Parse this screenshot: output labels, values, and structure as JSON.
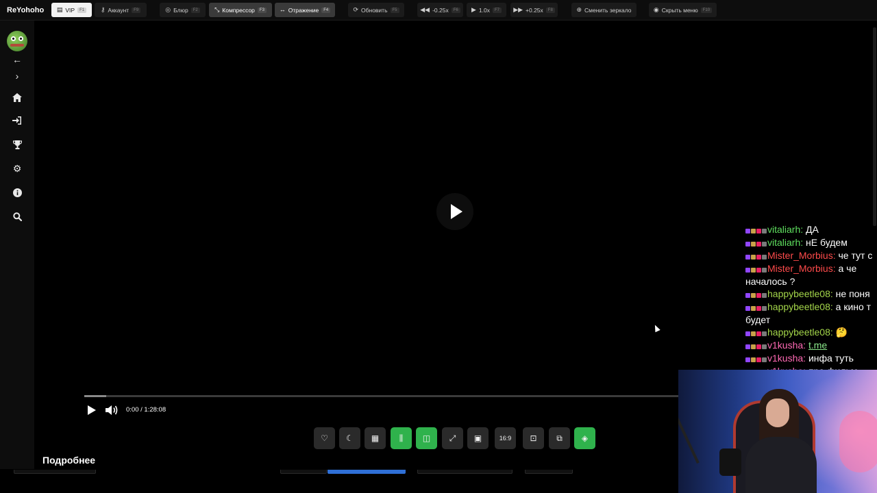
{
  "topbar": {
    "brand": "ReYohoho",
    "buttons": [
      {
        "label": "VIP",
        "key": "F1"
      },
      {
        "label": "Аккаунт",
        "key": "F9"
      },
      {
        "label": "Блюр",
        "key": "F2"
      },
      {
        "label": "Компрессор",
        "key": "F3"
      },
      {
        "label": "Отражение",
        "key": "F4"
      },
      {
        "label": "Обновить",
        "key": "F5"
      },
      {
        "label": "-0.25x",
        "key": "F6"
      },
      {
        "label": "1.0x",
        "key": "F7"
      },
      {
        "label": "+0.25x",
        "key": "F8"
      },
      {
        "label": "Сменить зеркало"
      },
      {
        "label": "Скрыть меню",
        "key": "F10"
      }
    ]
  },
  "player": {
    "time": "0:00 / 1:28:08",
    "progress_fraction": 0.037,
    "aspect_label": "16:9"
  },
  "details_label": "Подробнее",
  "chat": [
    {
      "nick": "vitaliarh",
      "color": "#5fe05f",
      "text": "ДА"
    },
    {
      "nick": "vitaliarh",
      "color": "#5fe05f",
      "text": "нЕ будем"
    },
    {
      "nick": "Mister_Morbius",
      "color": "#ff4b4b",
      "text": "че тут с"
    },
    {
      "nick": "Mister_Morbius",
      "color": "#ff4b4b",
      "text": "а че"
    },
    {
      "cont": "началось ?"
    },
    {
      "nick": "happybeetle08",
      "color": "#a4d64a",
      "text": "не поня"
    },
    {
      "nick": "happybeetle08",
      "color": "#a4d64a",
      "text": "а кино т"
    },
    {
      "cont": "будет"
    },
    {
      "nick": "happybeetle08",
      "color": "#a4d64a",
      "text": "🤔"
    },
    {
      "nick": "v1kusha",
      "color": "#ff69b4",
      "link": "t.me"
    },
    {
      "nick": "v1kusha",
      "color": "#ff69b4",
      "text": "инфа туть"
    },
    {
      "nick": "v1kusha",
      "color": "#ff69b4",
      "text": "про фильм"
    }
  ]
}
